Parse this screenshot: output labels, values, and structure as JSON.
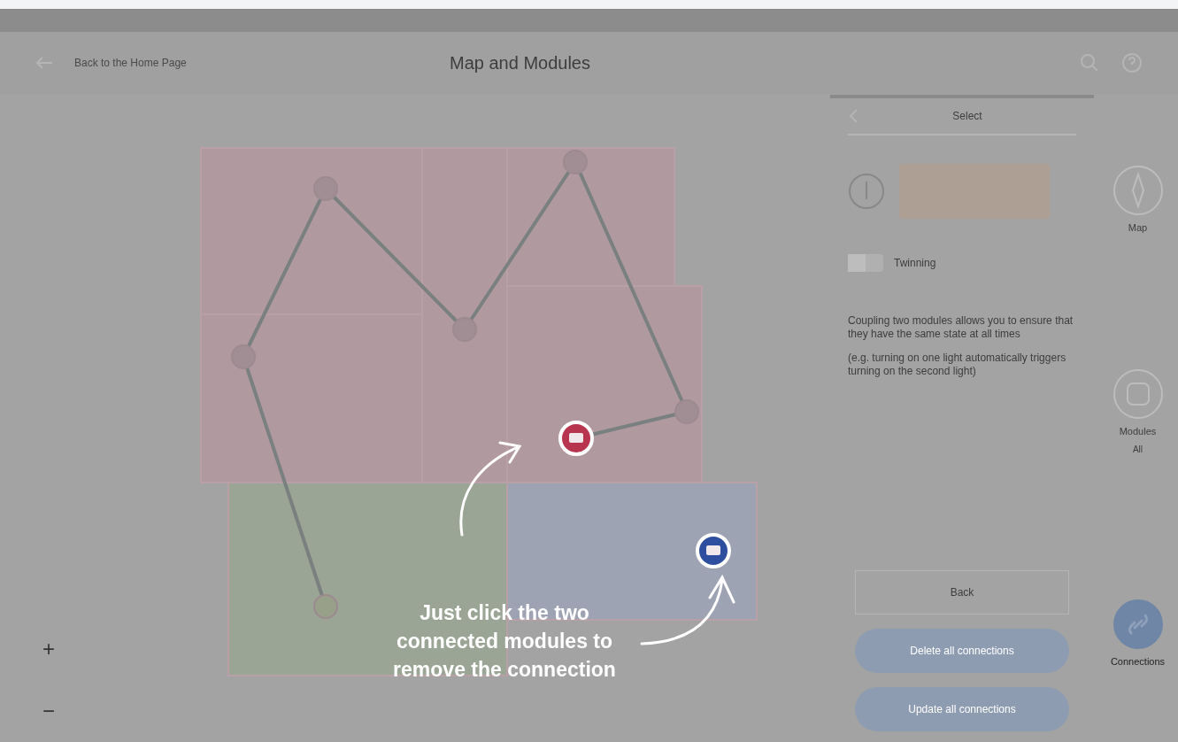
{
  "header": {
    "back_link": "Back to the Home Page",
    "title": "Map and Modules"
  },
  "map": {
    "rooms": [
      {
        "color": "#b09aa0"
      },
      {
        "color": "#b09aa0"
      },
      {
        "color": "#b09aa0"
      },
      {
        "color": "#b09aa0"
      },
      {
        "color": "#b09aa0"
      },
      {
        "color": "#9aa595"
      },
      {
        "color": "#9ea3b3"
      }
    ],
    "nodes": [
      {
        "selected": false,
        "color": "#a08e94"
      },
      {
        "selected": false,
        "color": "#a08e94"
      },
      {
        "selected": false,
        "color": "#a08e94"
      },
      {
        "selected": false,
        "color": "#a08e94"
      },
      {
        "selected": false,
        "color": "#a08e94"
      },
      {
        "selected": false,
        "color": "#98a08a"
      },
      {
        "selected": true,
        "color": "#b8354f"
      },
      {
        "selected": true,
        "color": "#2e4fa0"
      }
    ],
    "zoom_controls": [
      "+",
      "−"
    ]
  },
  "hint": "Just click the two connected modules to remove the connection",
  "panel": {
    "title": "Select",
    "toggle": {
      "label": "Twinning",
      "on": false
    },
    "paragraphs": [
      "Coupling two modules allows you to ensure that they have the same state at all times",
      "(e.g. turning on one light automatically triggers turning on the second light)"
    ],
    "buttons": [
      {
        "label": "Back",
        "kind": "outline"
      },
      {
        "label": "Delete all connections",
        "kind": "filled"
      },
      {
        "label": "Update all connections",
        "kind": "filled"
      }
    ]
  },
  "side_nav": [
    {
      "label": "Map",
      "selected": false
    },
    {
      "label": "Modules",
      "sub": "All",
      "selected": false
    },
    {
      "label": "Connections",
      "selected": true
    }
  ]
}
